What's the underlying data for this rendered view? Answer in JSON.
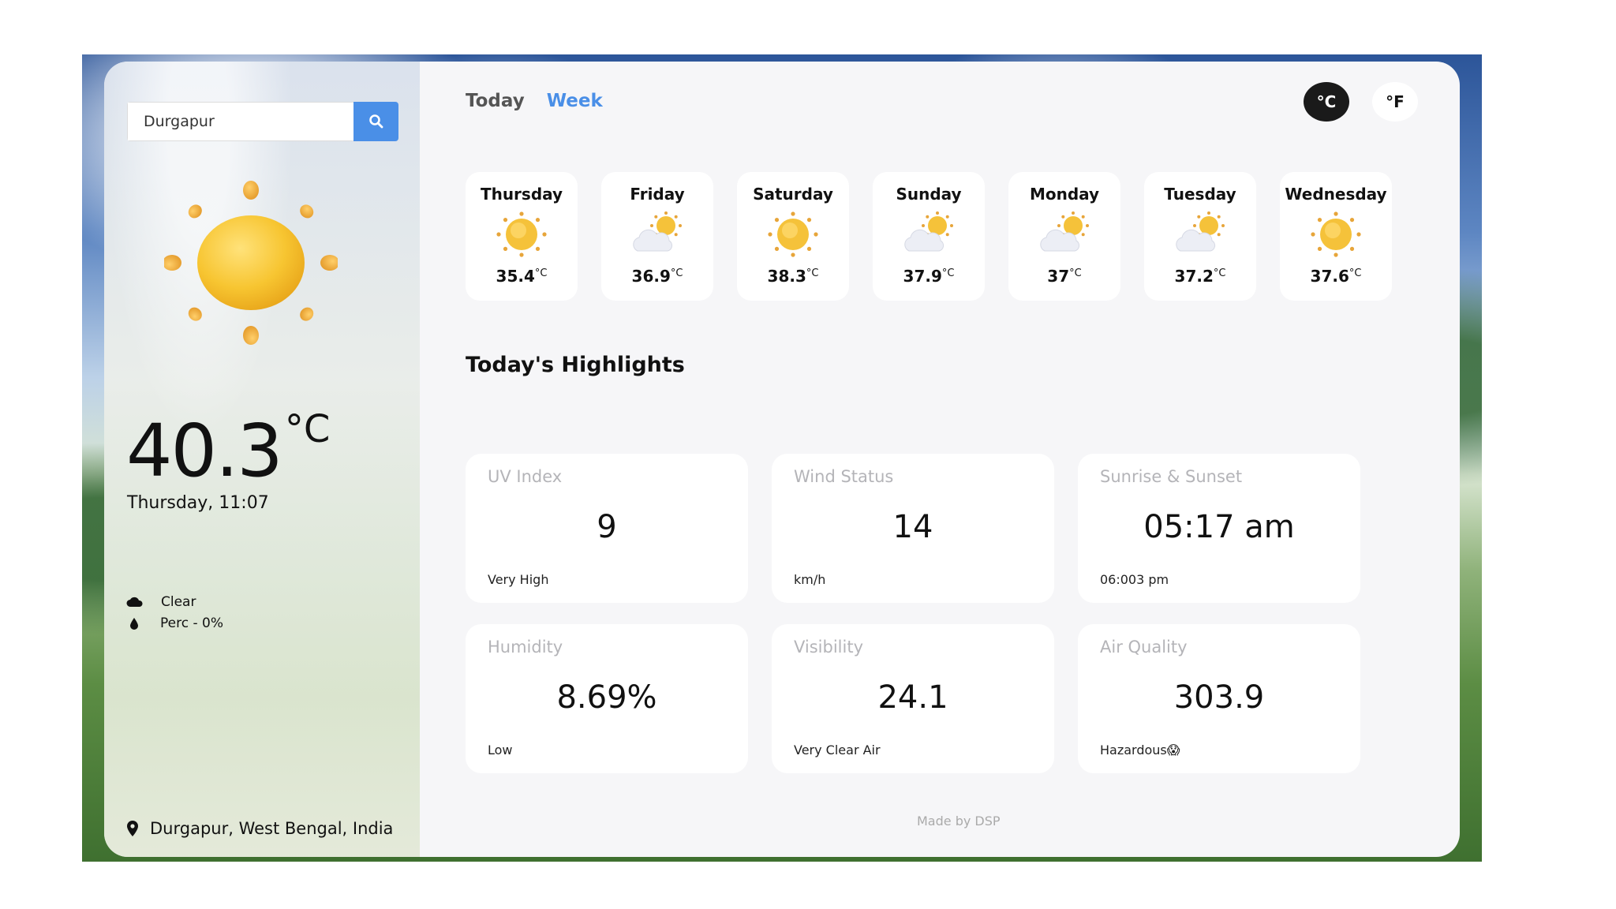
{
  "search": {
    "value": "Durgapur",
    "button_icon": "search-icon"
  },
  "current": {
    "temp": "40.3",
    "unit": "°C",
    "datetime": "Thursday, 11:07",
    "condition_icon": "cloud-icon",
    "condition": "Clear",
    "precip_icon": "drop-icon",
    "precip": "Perc - 0%",
    "location_icon": "map-pin-icon",
    "location": "Durgapur, West Bengal, India"
  },
  "tabs": {
    "today": "Today",
    "week": "Week",
    "active": "week"
  },
  "units": {
    "c": "°C",
    "f": "°F",
    "active": "c"
  },
  "forecast": [
    {
      "day": "Thursday",
      "icon": "sun-icon",
      "temp": "35.4",
      "unit": "°C"
    },
    {
      "day": "Friday",
      "icon": "partly-cloudy-icon",
      "temp": "36.9",
      "unit": "°C"
    },
    {
      "day": "Saturday",
      "icon": "sun-icon",
      "temp": "38.3",
      "unit": "°C"
    },
    {
      "day": "Sunday",
      "icon": "partly-cloudy-icon",
      "temp": "37.9",
      "unit": "°C"
    },
    {
      "day": "Monday",
      "icon": "partly-cloudy-icon",
      "temp": "37",
      "unit": "°C"
    },
    {
      "day": "Tuesday",
      "icon": "partly-cloudy-icon",
      "temp": "37.2",
      "unit": "°C"
    },
    {
      "day": "Wednesday",
      "icon": "sun-icon",
      "temp": "37.6",
      "unit": "°C"
    }
  ],
  "highlights": {
    "title": "Today's Highlights",
    "cards": [
      {
        "label": "UV Index",
        "value": "9",
        "sub": "Very High"
      },
      {
        "label": "Wind Status",
        "value": "14",
        "sub": "km/h"
      },
      {
        "label": "Sunrise & Sunset",
        "value": "05:17 am",
        "sub": "06:003 pm"
      },
      {
        "label": "Humidity",
        "value": "8.69%",
        "sub": "Low"
      },
      {
        "label": "Visibility",
        "value": "24.1",
        "sub": "Very Clear Air"
      },
      {
        "label": "Air Quality",
        "value": "303.9",
        "sub": "Hazardous😱"
      }
    ]
  },
  "footer": "Made by DSP",
  "colors": {
    "accent": "#4a8fe7",
    "unit_active_bg": "#1a1a1a",
    "card_bg": "#f6f6f8"
  }
}
